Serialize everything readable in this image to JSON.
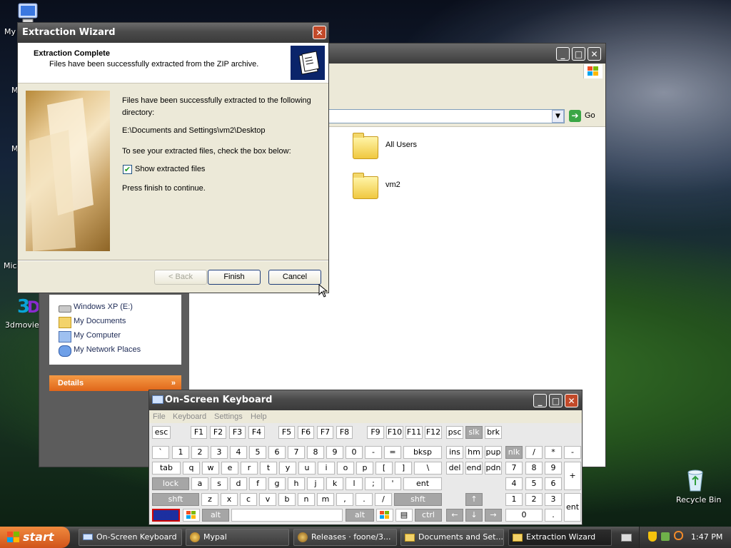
{
  "desktop": {
    "icons": [
      {
        "label": "My",
        "icon": "monitor-icon"
      },
      {
        "label": "Micr",
        "icon": "app-icon"
      },
      {
        "label": "3dmovie",
        "icon": "3dmovie-icon"
      },
      {
        "label": "Recycle Bin",
        "icon": "recycle-bin-icon"
      }
    ]
  },
  "explorer": {
    "address_go": "Go",
    "folders": [
      "All Users",
      "vm2"
    ],
    "other_places": [
      "Windows XP (E:)",
      "My Documents",
      "My Computer",
      "My Network Places"
    ],
    "details_label": "Details"
  },
  "wizard": {
    "title": "Extraction Wizard",
    "header_title": "Extraction Complete",
    "header_subtitle": "Files have been successfully extracted from the ZIP archive.",
    "body_line1": "Files have been successfully extracted to the following",
    "body_line2": "directory:",
    "path": "E:\\Documents and Settings\\vm2\\Desktop",
    "check_prompt": "To see your extracted files, check the box below:",
    "checkbox_label": "Show extracted files",
    "checkbox_checked": true,
    "finish_prompt": "Press finish to continue.",
    "back_label": "< Back",
    "finish_label": "Finish",
    "cancel_label": "Cancel"
  },
  "osk": {
    "title": "On-Screen Keyboard",
    "menu": [
      "File",
      "Keyboard",
      "Settings",
      "Help"
    ],
    "row0": [
      "esc",
      "F1",
      "F2",
      "F3",
      "F4",
      "F5",
      "F6",
      "F7",
      "F8",
      "F9",
      "F10",
      "F11",
      "F12",
      "psc",
      "slk",
      "brk"
    ],
    "row1": [
      "`",
      "1",
      "2",
      "3",
      "4",
      "5",
      "6",
      "7",
      "8",
      "9",
      "0",
      "-",
      "=",
      "bksp",
      "ins",
      "hm",
      "pup",
      "nlk",
      "/",
      "*",
      "-"
    ],
    "row2": [
      "tab",
      "q",
      "w",
      "e",
      "r",
      "t",
      "y",
      "u",
      "i",
      "o",
      "p",
      "[",
      "]",
      "\\",
      "del",
      "end",
      "pdn",
      "7",
      "8",
      "9",
      "+"
    ],
    "row3": [
      "lock",
      "a",
      "s",
      "d",
      "f",
      "g",
      "h",
      "j",
      "k",
      "l",
      ";",
      "'",
      "ent",
      "4",
      "5",
      "6"
    ],
    "row4": [
      "shft",
      "z",
      "x",
      "c",
      "v",
      "b",
      "n",
      "m",
      ",",
      ".",
      "/",
      "shft",
      "1",
      "2",
      "3",
      "ent"
    ],
    "row5": [
      "ctrl",
      "alt",
      "alt",
      "ctrl",
      "0",
      "."
    ]
  },
  "taskbar": {
    "start_label": "start",
    "items": [
      {
        "label": "On-Screen Keyboard",
        "icon": "keyboard-icon"
      },
      {
        "label": "Mypal",
        "icon": "mypal-icon"
      },
      {
        "label": "Releases · foone/3...",
        "icon": "download-icon"
      },
      {
        "label": "Documents and Set...",
        "icon": "folder-icon"
      },
      {
        "label": "Extraction Wizard",
        "icon": "folder-icon"
      }
    ],
    "clock": "1:47 PM"
  },
  "colors": {
    "wizard_header_icon_bg": "#0a246a",
    "details_bar": "#f07c22",
    "key_pressed_border": "#d00000"
  }
}
